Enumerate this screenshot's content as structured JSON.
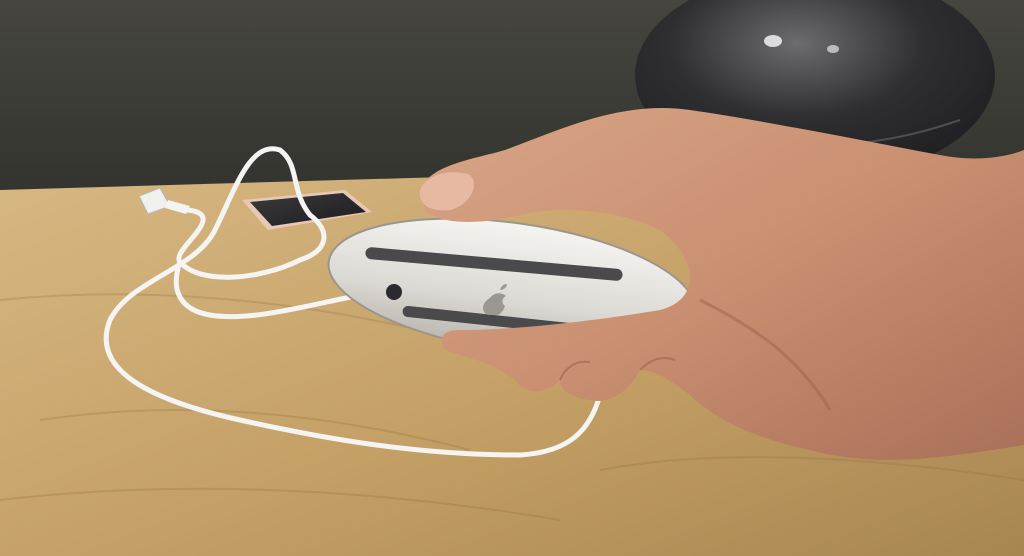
{
  "scene": {
    "subjects": [
      "hand",
      "magic-mouse",
      "lightning-cable",
      "usb-plug",
      "smartphone",
      "glass-lamp",
      "wooden-desk"
    ],
    "colors": {
      "wall": "#3d3d39",
      "desk": "#c9a56a",
      "desk_highlight": "#e2c58f",
      "mouse_body": "#e8e6e1",
      "mouse_rail": "#4a4a4c",
      "cable": "#f4f4f2",
      "skin": "#d19c7c",
      "skin_shadow": "#a8705a",
      "phone_screen": "#2a2a2c",
      "phone_frame": "#e7c8b4",
      "lamp_glass": "#3a3a3c"
    }
  }
}
